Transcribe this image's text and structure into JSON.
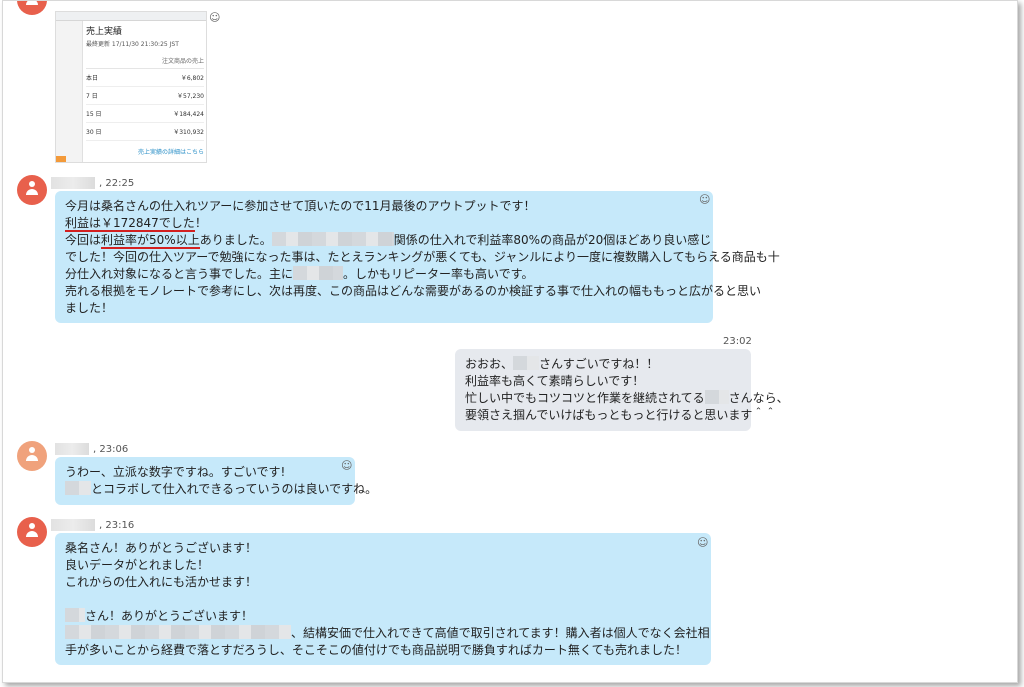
{
  "screenshot": {
    "title": "売上実績",
    "updated": "最終更新 17/11/30 21:30:25 JST",
    "column_header": "注文商品の売上",
    "rows": [
      {
        "label": "本日",
        "value": "￥6,802"
      },
      {
        "label": "7 日",
        "value": "￥57,230"
      },
      {
        "label": "15 日",
        "value": "￥184,424"
      },
      {
        "label": "30 日",
        "value": "￥310,932"
      }
    ],
    "link": "売上実績の詳細はこちら"
  },
  "messages": {
    "m1": {
      "time": ", 22:25",
      "line1": "今月は桑名さんの仕入れツアーに参加させて頂いたので11月最後のアウトプットです！",
      "line2_underlined": "利益は￥172847でした",
      "line2_rest": "！",
      "line3_prefix": "今回は",
      "line3_underlined": "利益率が50%以上",
      "line3_mid": "ありました。",
      "line3_suffix": "関係の仕入れで利益率80%の商品が20個ほどあり良い感じ",
      "line4": "でした！今回の仕入ツアーで勉強になった事は、たとえランキングが悪くても、ジャンルにより一度に複数購入してもらえる商品も十",
      "line5_prefix": "分仕入れ対象になると言う事でした。主に",
      "line5_suffix": "。しかもリピーター率も高いです。",
      "line6": "売れる根拠をモノレートで参考にし、次は再度、この商品はどんな需要があるのか検証する事で仕入れの幅ももっと広がると思い",
      "line7": "ました！"
    },
    "m2": {
      "time": "23:02",
      "line1_prefix": "おおお、",
      "line1_suffix": "さんすごいですね！！",
      "line2": "利益率も高くて素晴らしいです！",
      "line3_prefix": "忙しい中でもコツコツと作業を継続されてる",
      "line3_suffix": "さんなら、",
      "line4": "要領さえ掴んでいけばもっともっと行けると思います＾＾"
    },
    "m3": {
      "time": ", 23:06",
      "line1": "うわー、立派な数字ですね。すごいです!",
      "line2_suffix": "とコラボして仕入れできるっていうのは良いですね。"
    },
    "m4": {
      "time": ", 23:16",
      "line1": "桑名さん！ありがとうございます！",
      "line2": "良いデータがとれました！",
      "line3": "これからの仕入れにも活かせます！",
      "line4_suffix": "さん！ありがとうございます！",
      "line5_suffix": "、結構安価で仕入れできて高値で取引されてます！購入者は個人でなく会社相",
      "line6": "手が多いことから経費で落とすだろうし、そこそこの値付けでも商品説明で勝負すればカート無くても売れました！"
    }
  },
  "icons": {
    "reaction": "smiley-icon",
    "avatar": "user-avatar-icon"
  },
  "colors": {
    "incoming_bubble": "#c6e9fa",
    "outgoing_bubble": "#e6e9ee",
    "avatar": "#e8604c",
    "avatar_light": "#f0a27c",
    "underline": "#d32020"
  }
}
